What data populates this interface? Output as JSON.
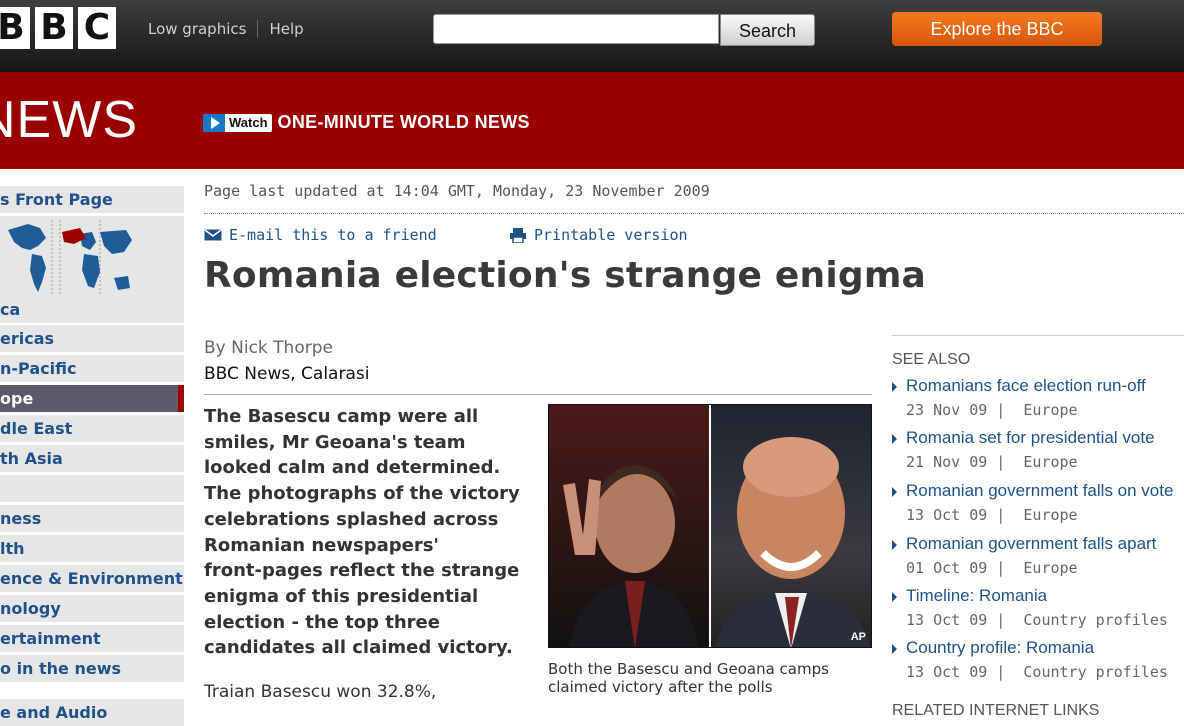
{
  "header": {
    "logo_letters": [
      "B",
      "B",
      "C"
    ],
    "links": [
      "Low graphics",
      "Help"
    ],
    "search_button": "Search",
    "search_value": "",
    "explore_button": "Explore the BBC"
  },
  "banner": {
    "logo": "NEWS",
    "watch_label": "Watch",
    "watch_title": "ONE-MINUTE WORLD NEWS"
  },
  "sidebar": {
    "items": [
      "s Front Page",
      "ca",
      "ericas",
      "n-Pacific",
      "ope",
      "dle East",
      "th Asia",
      "",
      "ness",
      "lth",
      "ence & Environment",
      "nology",
      "ertainment",
      "o in the news",
      "e and Audio"
    ],
    "active_index": 4
  },
  "article": {
    "updated": "Page last updated at 14:04 GMT, Monday, 23 November 2009",
    "email_link": "E-mail this to a friend",
    "print_link": "Printable version",
    "headline": "Romania election's strange enigma",
    "byline": "By Nick Thorpe",
    "byline_location": "BBC News, Calarasi",
    "intro_lines": [
      "The Basescu camp were all",
      "smiles, Mr Geoana's team",
      "looked calm and determined.",
      "The photographs of the victory",
      "celebrations splashed across",
      "Romanian newspapers'",
      "front-pages reflect the strange",
      "enigma of this presidential",
      "election - the top three",
      "candidates all claimed victory."
    ],
    "para2": "Traian Basescu won 32.8%,",
    "photo_credit": "AP",
    "caption": "Both the Basescu and Geoana camps claimed victory after the polls"
  },
  "see_also": {
    "title": "SEE ALSO",
    "items": [
      {
        "title": "Romanians face election run-off",
        "date": "23 Nov 09",
        "section": "Europe"
      },
      {
        "title": "Romania set for presidential vote",
        "date": "21 Nov 09",
        "section": "Europe"
      },
      {
        "title": "Romanian government falls on vote",
        "date": "13 Oct 09",
        "section": "Europe"
      },
      {
        "title": "Romanian government falls apart",
        "date": "01 Oct 09",
        "section": "Europe"
      },
      {
        "title": "Timeline: Romania",
        "date": "13 Oct 09",
        "section": "Country profiles"
      },
      {
        "title": "Country profile: Romania",
        "date": "13 Oct 09",
        "section": "Country profiles"
      }
    ],
    "related_title": "RELATED INTERNET LINKS"
  },
  "colors": {
    "link": "#225188",
    "banner_red": "#9a0000",
    "explore_orange": "#e8650f"
  }
}
